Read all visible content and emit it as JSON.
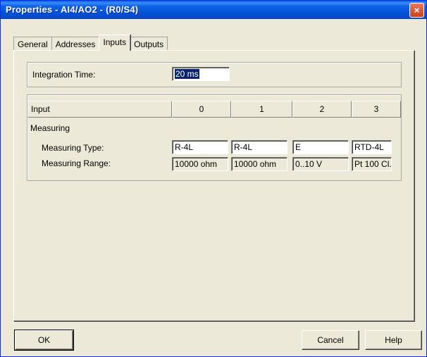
{
  "window": {
    "title": "Properties - AI4/AO2 - (R0/S4)",
    "close_glyph": "×"
  },
  "tabs": [
    {
      "label": "General"
    },
    {
      "label": "Addresses"
    },
    {
      "label": "Inputs",
      "active": true
    },
    {
      "label": "Outputs"
    }
  ],
  "integration": {
    "label": "Integration Time:",
    "value": "20 ms"
  },
  "table": {
    "header_label": "Input",
    "columns": [
      "0",
      "1",
      "2",
      "3"
    ],
    "section_label": "Measuring",
    "measuring_type": {
      "label": "Measuring Type:",
      "values": [
        "R-4L",
        "R-4L",
        "E",
        "RTD-4L"
      ]
    },
    "measuring_range": {
      "label": "Measuring Range:",
      "values": [
        "10000 ohm",
        "10000 ohm",
        "0..10 V",
        "Pt 100 Cl."
      ]
    }
  },
  "buttons": {
    "ok": "OK",
    "cancel": "Cancel",
    "help": "Help"
  },
  "colors": {
    "titlebar": "#0351d6",
    "selection": "#0a246a",
    "face": "#ece9d8"
  }
}
